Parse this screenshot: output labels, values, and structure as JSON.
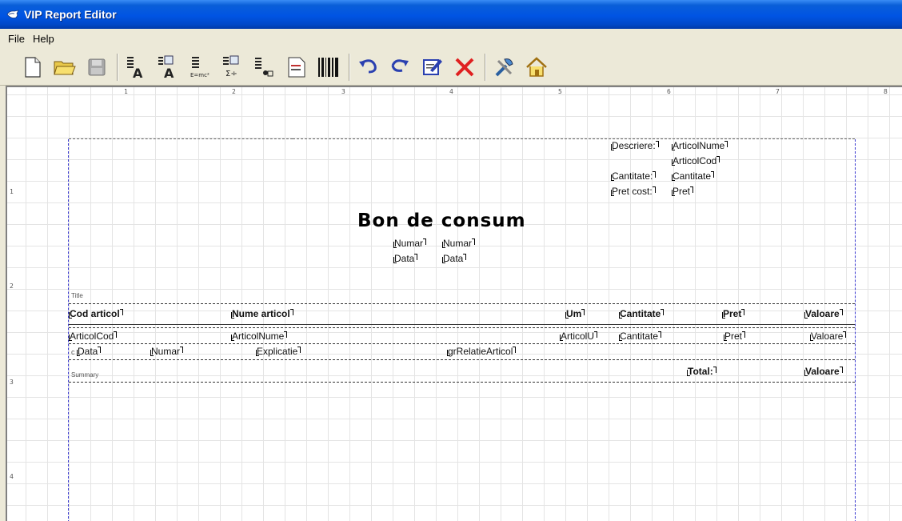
{
  "window": {
    "title": "VIP Report Editor"
  },
  "menu": {
    "file": "File",
    "help": "Help"
  },
  "toolbar": {
    "buttons": [
      {
        "icon": "new-document-icon"
      },
      {
        "icon": "open-folder-icon"
      },
      {
        "icon": "save-disk-icon"
      },
      {
        "icon": "text-label-icon"
      },
      {
        "icon": "data-field-icon"
      },
      {
        "icon": "expression-icon"
      },
      {
        "icon": "sum-field-icon"
      },
      {
        "icon": "image-field-icon"
      },
      {
        "icon": "memo-icon"
      },
      {
        "icon": "barcode-icon"
      },
      {
        "icon": "undo-icon"
      },
      {
        "icon": "redo-icon"
      },
      {
        "icon": "edit-properties-icon"
      },
      {
        "icon": "delete-icon"
      },
      {
        "icon": "tools-icon"
      },
      {
        "icon": "home-icon"
      }
    ],
    "formula_label": "E=mc²"
  },
  "ruler": {
    "top": [
      "1",
      "2",
      "3",
      "4",
      "5",
      "6",
      "7",
      "8"
    ],
    "left": [
      "1",
      "2",
      "3",
      "4"
    ]
  },
  "report": {
    "title_text": "Bon de consum",
    "header_fields": {
      "descriere": "Descriere:",
      "articol_nume": "ArticolNume",
      "articol_cod": "ArticolCod",
      "cantitate_label": "Cantitate:",
      "cantitate": "Cantitate",
      "pret_cost": "Pret cost:",
      "pret": "Pret",
      "numar_label": "Numar",
      "numar": "Numar",
      "data_label": "Data",
      "data": "Data"
    },
    "bands": {
      "title": "Title",
      "summary": "Summary"
    },
    "columns": [
      "Cod articol",
      "Nume articol",
      "Um",
      "Cantitate",
      "Pret",
      "Valoare"
    ],
    "detail": [
      "ArticolCod",
      "ArticolNume",
      "ArticolU",
      "Cantitate",
      "Pret",
      "Valoare"
    ],
    "subdetail": [
      "Data",
      "Numar",
      "Explicatie",
      "grRelatieArticol"
    ],
    "subdetail_prefix": "c",
    "summary": {
      "total_label": "Total:",
      "total_value": "Valoare"
    }
  }
}
